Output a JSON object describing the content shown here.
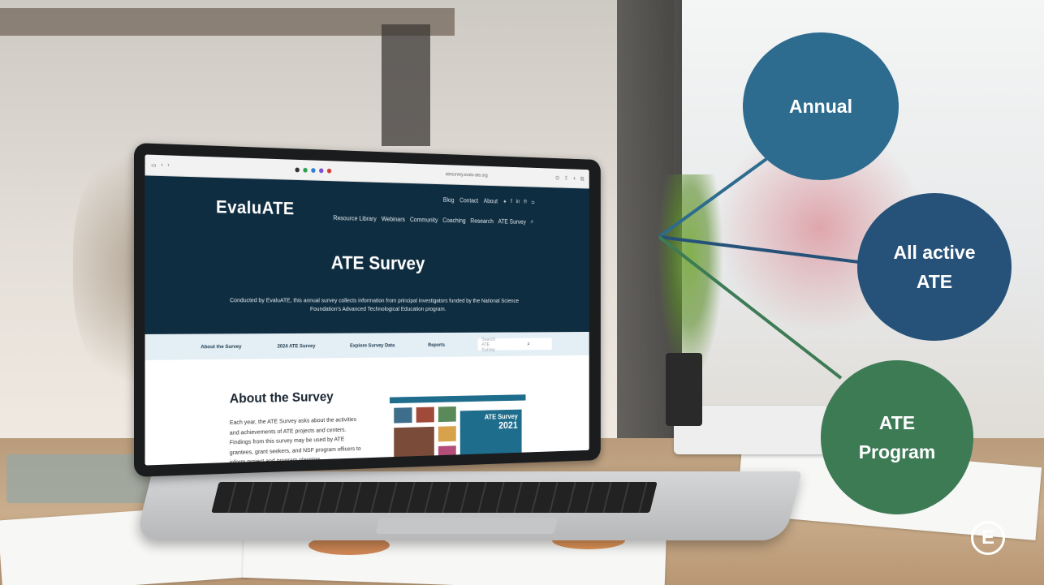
{
  "browser": {
    "url": "atesurvey.evalu-ate.org"
  },
  "site": {
    "logo": "EvaluATE",
    "top_nav": [
      "Blog",
      "Contact",
      "About"
    ],
    "social_icons": [
      "twitter-icon",
      "facebook-icon",
      "linkedin-icon",
      "pinterest-icon",
      "rss-icon"
    ],
    "main_nav": [
      "Resource Library",
      "Webinars",
      "Community",
      "Coaching",
      "Research",
      "ATE Survey"
    ],
    "hero_title": "ATE Survey",
    "hero_subtitle": "Conducted by EvaluATE, this annual survey collects information from principal investigators funded by the National Science Foundation's Advanced Technological Education program.",
    "sub_nav": [
      "About the Survey",
      "2024 ATE Survey",
      "Explore Survey Data",
      "Reports"
    ],
    "search_placeholder": "Search ATE Survey",
    "about_title": "About the Survey",
    "about_text": "Each year, the ATE Survey asks about the activities and achievements of ATE projects and centers. Findings from this survey may be used by ATE grantees, grant seekers, and NSF program officers to inform project and program planning",
    "report_title": "ATE Survey",
    "report_year": "2021"
  },
  "callouts": {
    "annual": "Annual",
    "all_active": "All active ATE",
    "ate_program": "ATE Program"
  },
  "colors": {
    "annual": "#2d6c8f",
    "all_active": "#26527a",
    "ate_program": "#3d7b55",
    "site_header": "#0f2d40"
  },
  "brand_mark": "E"
}
